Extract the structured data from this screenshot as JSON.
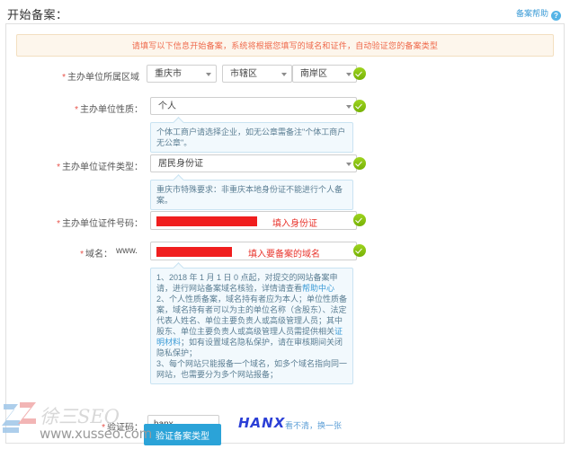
{
  "header": {
    "title": "开始备案：",
    "help_link": "备案帮助",
    "help_icon": "question-mark-icon"
  },
  "alert": {
    "text": "请填写以下信息开始备案，系统将根据您填写的域名和证件，自动验证您的备案类型"
  },
  "form": {
    "region": {
      "label": "主办单位所属区域",
      "required": "*",
      "province": "重庆市",
      "city": "市辖区",
      "district": "南岸区",
      "valid_icon": "green-check-icon"
    },
    "nature": {
      "label": "主办单位性质：",
      "required": "*",
      "value": "个人",
      "valid_icon": "green-check-icon",
      "tip": "个体工商户请选择企业，如无公章需备注\"个体工商户无公章\"。"
    },
    "cert_type": {
      "label": "主办单位证件类型：",
      "required": "*",
      "value": "居民身份证",
      "valid_icon": "green-check-icon",
      "tip": "重庆市特殊要求：非重庆本地身份证不能进行个人备案。"
    },
    "cert_number": {
      "label": "主办单位证件号码：",
      "required": "*",
      "value": "",
      "redacted": true,
      "annotation": "填入身份证",
      "valid_icon": "green-check-icon"
    },
    "domain": {
      "label": "域名：",
      "required": "*",
      "prefix": "www.",
      "value": "",
      "redacted": true,
      "annotation": "填入要备案的域名",
      "valid_icon": "green-check-icon",
      "tips": [
        {
          "text_before": "1、2018 年 1 月 1 日 0 点起，对提交的网站备案申请，进行网站备案域名核验，详情请查看",
          "link": "帮助中心",
          "text_after": ""
        },
        {
          "text_before": "2、个人性质备案，域名持有者应为本人；单位性质备案，域名持有者可以为主的单位名称（含股东）、法定代表人姓名、单位主要负责人或高级管理人员；其中股东、单位主要负责人或高级管理人员需提供相关",
          "link": "证明材料",
          "text_after": "；如有设置域名隐私保护，请在审核期间关闭隐私保护；"
        },
        {
          "text_before": "3、每个网站只能报备一个域名，如多个域名指向同一网站，也需要分为多个网站报备；",
          "link": "",
          "text_after": ""
        }
      ]
    },
    "captcha": {
      "label": "验证码：",
      "required": "*",
      "value": "hanx",
      "image_text": "HANX",
      "refresh_link": "看不清，换一张"
    }
  },
  "submit": {
    "label": "验证备案类型"
  },
  "watermark": {
    "brand": "徐三SEO",
    "url": "www.xusseo.com",
    "logo": "xz-logo-icon"
  },
  "colors": {
    "accent": "#2ba3d8",
    "alert_text": "#ef6a4c",
    "alert_bg": "#fdf6ec",
    "valid_green": "#86c40c",
    "annotation_red": "#e8342c",
    "tip_bg": "#f2f9fd",
    "redaction": "#f01e1e"
  }
}
